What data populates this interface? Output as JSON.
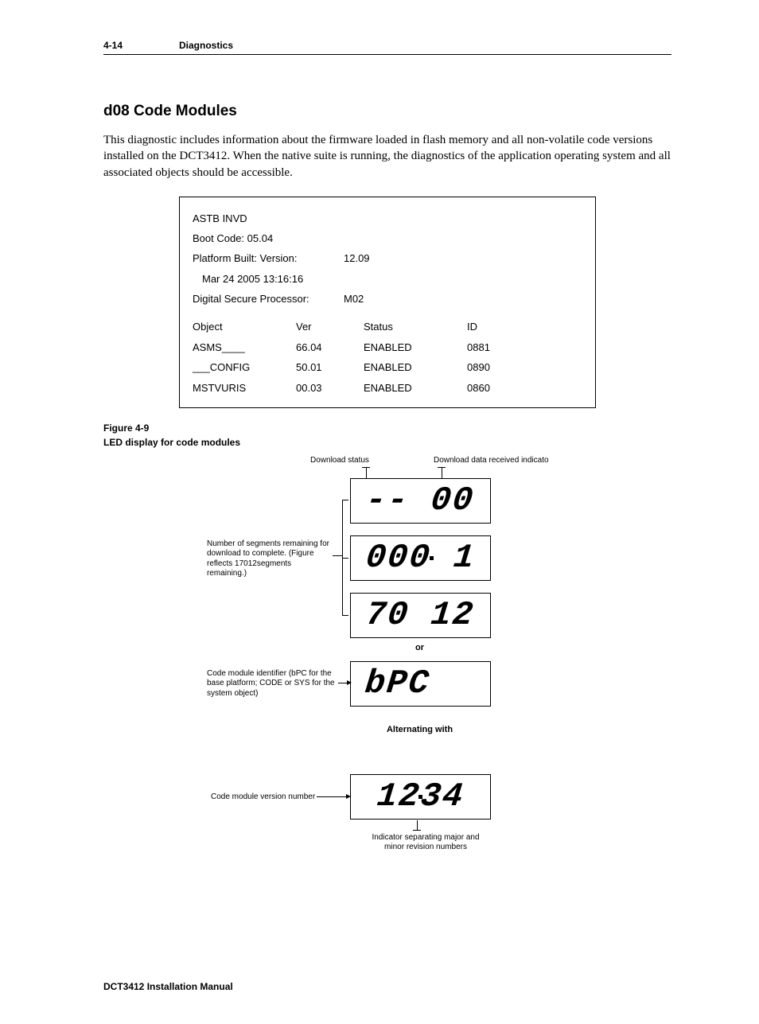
{
  "header": {
    "page_num": "4-14",
    "section": "Diagnostics"
  },
  "title": "d08 Code Modules",
  "paragraph": "This diagnostic includes information about the firmware loaded in flash memory and all non-volatile code versions installed on the DCT3412. When the native suite is running, the diagnostics of the application operating system and all associated objects should be accessible.",
  "panel": {
    "line1": "ASTB INVD",
    "line2": "Boot Code: 05.04",
    "pbv_label": "Platform Built: Version:",
    "pbv_value": "12.09",
    "pbv_date": "Mar 24 2005  13:16:16",
    "dsp_label": "Digital Secure Processor:",
    "dsp_value": "M02",
    "headers": {
      "obj": "Object",
      "ver": "Ver",
      "stat": "Status",
      "id": "ID"
    },
    "rows": [
      {
        "obj": "ASMS____",
        "ver": "66.04",
        "stat": "ENABLED",
        "id": "0881"
      },
      {
        "obj": "___CONFIG",
        "ver": "50.01",
        "stat": "ENABLED",
        "id": "0890"
      },
      {
        "obj": "MSTVURIS",
        "ver": "00.03",
        "stat": "ENABLED",
        "id": "0860"
      }
    ]
  },
  "figure": {
    "num": "Figure 4-9",
    "title": "LED display for code modules"
  },
  "diagram": {
    "callout_dl_status": "Download status",
    "callout_dl_indicator": "Download data received indicato",
    "callout_segments": "Number of segments remaining for download to complete. (Figure reflects 17012segments remaining.)",
    "callout_module_id": "Code module identifier (bPC for the base platform; CODE or SYS for the system object)",
    "callout_version": "Code module version number",
    "callout_separator": "Indicator separating major and minor revision numbers",
    "lcd1": "- - 00",
    "lcd2": "000 1",
    "lcd3": "70 12",
    "lcd4": "bPC",
    "lcd5": "12.34",
    "or": "or",
    "alternating": "Alternating with"
  },
  "footer": "DCT3412 Installation Manual"
}
